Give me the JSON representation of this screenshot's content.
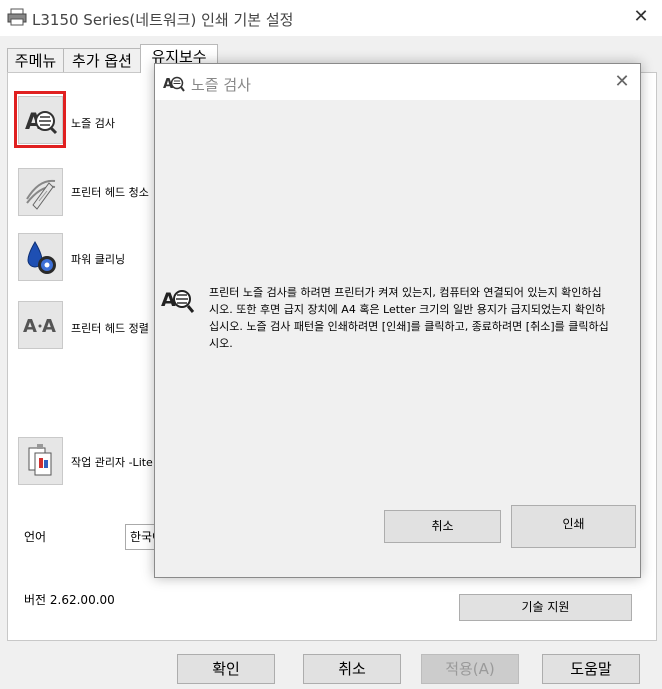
{
  "window": {
    "title": "L3150 Series(네트워크) 인쇄 기본 설정",
    "close": "✕"
  },
  "tabs": [
    {
      "label": "주메뉴"
    },
    {
      "label": "추가 옵션"
    },
    {
      "label": "유지보수"
    }
  ],
  "tools": [
    {
      "label": "노즐 검사"
    },
    {
      "label": "프린터 헤드 청소"
    },
    {
      "label": "파워 클리닝"
    },
    {
      "label": "프린터 헤드 정렬"
    },
    {
      "label": "작업 관리자 -Lite"
    }
  ],
  "language": {
    "label": "언어",
    "value": "한국어"
  },
  "version": "버전 2.62.00.00",
  "support_button": "기술 지원",
  "bottom_buttons": {
    "ok": "확인",
    "cancel": "취소",
    "apply": "적용(A)",
    "help": "도움말"
  },
  "dialog": {
    "title": "노즐 검사",
    "close": "✕",
    "message": "프린터 노즐 검사를 하려면 프린터가 켜져 있는지, 컴퓨터와 연결되어 있는지 확인하십시오. 또한 후면 급지 장치에 A4 혹은 Letter 크기의 일반 용지가 급지되었는지 확인하십시오. 노즐 검사 패턴을 인쇄하려면 [인쇄]를 클릭하고, 종료하려면 [취소]를 클릭하십시오.",
    "cancel": "취소",
    "print": "인쇄"
  },
  "colors": {
    "highlight": "#e02020",
    "window_bg": "#f0f0f0",
    "panel_bg": "#ffffff"
  }
}
